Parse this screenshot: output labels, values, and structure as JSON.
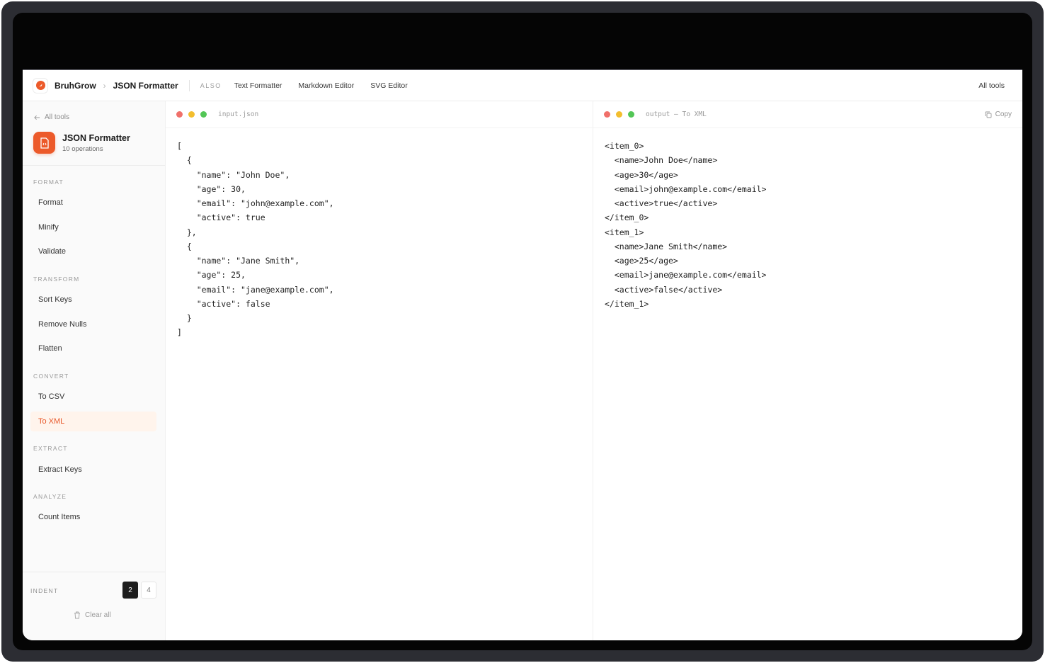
{
  "topbar": {
    "brand": "BruhGrow",
    "breadcrumb_current": "JSON Formatter",
    "also_label": "ALSO",
    "links": [
      "Text Formatter",
      "Markdown Editor",
      "SVG Editor"
    ],
    "all_tools": "All tools"
  },
  "sidebar": {
    "back_label": "All tools",
    "tool_title": "JSON Formatter",
    "tool_subtitle": "10 operations",
    "sections": [
      {
        "label": "FORMAT",
        "items": [
          "Format",
          "Minify",
          "Validate"
        ]
      },
      {
        "label": "TRANSFORM",
        "items": [
          "Sort Keys",
          "Remove Nulls",
          "Flatten"
        ]
      },
      {
        "label": "CONVERT",
        "items": [
          "To CSV",
          "To XML"
        ]
      },
      {
        "label": "EXTRACT",
        "items": [
          "Extract Keys"
        ]
      },
      {
        "label": "ANALYZE",
        "items": [
          "Count Items"
        ]
      }
    ],
    "active_item": "To XML",
    "indent_label": "INDENT",
    "indent_options": [
      "2",
      "4"
    ],
    "indent_selected": "2",
    "clear_all": "Clear all"
  },
  "input_pane": {
    "filename": "input.json",
    "content": "[\n  {\n    \"name\": \"John Doe\",\n    \"age\": 30,\n    \"email\": \"john@example.com\",\n    \"active\": true\n  },\n  {\n    \"name\": \"Jane Smith\",\n    \"age\": 25,\n    \"email\": \"jane@example.com\",\n    \"active\": false\n  }\n]"
  },
  "output_pane": {
    "filename": "output — To XML",
    "copy_label": "Copy",
    "content": "<item_0>\n  <name>John Doe</name>\n  <age>30</age>\n  <email>john@example.com</email>\n  <active>true</active>\n</item_0>\n<item_1>\n  <name>Jane Smith</name>\n  <age>25</age>\n  <email>jane@example.com</email>\n  <active>false</active>\n</item_1>"
  },
  "colors": {
    "accent": "#ec5a2a",
    "active_bg": "#fff4ec"
  }
}
